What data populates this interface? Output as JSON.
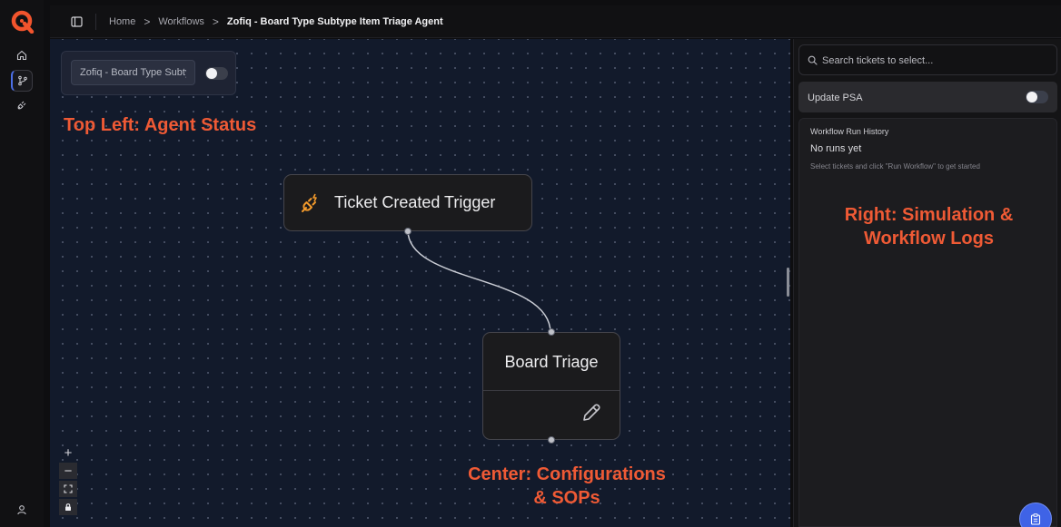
{
  "header": {
    "breadcrumbs": [
      "Home",
      "Workflows",
      "Zofiq - Board Type Subtype Item Triage Agent"
    ],
    "separator": ">"
  },
  "canvas": {
    "agent_name_value": "Zofiq - Board Type Subtype Item Triage Agent",
    "agent_toggle_on": false,
    "nodes": {
      "trigger": {
        "label": "Ticket Created Trigger",
        "icon": "plug-icon",
        "icon_color": "#f39a2b"
      },
      "triage": {
        "label": "Board Triage",
        "icon": "pencil-icon"
      }
    },
    "zoom_controls": [
      "+",
      "−"
    ]
  },
  "annotations": {
    "top_left": "Top Left: Agent Status",
    "right_line1": "Right: Simulation &",
    "right_line2": "Workflow Logs",
    "center_line1": "Center: Configurations",
    "center_line2": "& SOPs",
    "color": "#ef5a35"
  },
  "right_panel": {
    "search_placeholder": "Search tickets to select...",
    "update_psa_label": "Update PSA",
    "update_psa_on": false,
    "history_title": "Workflow Run History",
    "history_empty": "No runs yet",
    "history_hint": "Select tickets and click \"Run Workflow\" to get started"
  },
  "colors": {
    "brand": "#f2542d",
    "accent": "#3f63e6",
    "canvas_bg": "#121a2b"
  }
}
